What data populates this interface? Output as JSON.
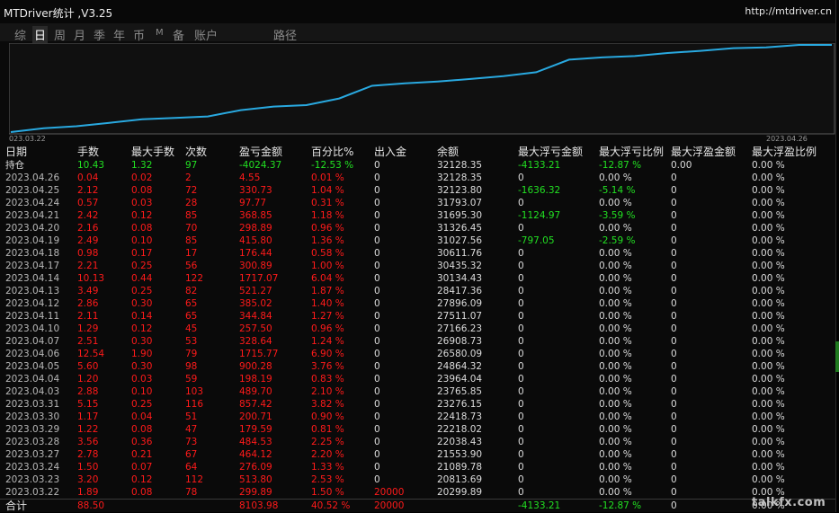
{
  "app": {
    "title": "MTDriver统计 ,V3.25",
    "site": "http://mtdriver.cn"
  },
  "tabs": [
    {
      "label": "综",
      "active": false
    },
    {
      "label": "日",
      "active": true
    },
    {
      "label": "周",
      "active": false
    },
    {
      "label": "月",
      "active": false
    },
    {
      "label": "季",
      "active": false
    },
    {
      "label": "年",
      "active": false
    },
    {
      "label": "币",
      "active": false
    },
    {
      "label": "M",
      "active": false
    },
    {
      "label": "备",
      "active": false
    },
    {
      "label": "账户",
      "active": false
    },
    {
      "label": "路径",
      "active": false
    }
  ],
  "chart_data": {
    "type": "line",
    "x_start_label": "023.03.22",
    "x_end_label": "2023.04.26",
    "series": [
      {
        "color": "#29a9e0",
        "x": [
          "2023.03.22",
          "2023.03.23",
          "2023.03.24",
          "2023.03.27",
          "2023.03.28",
          "2023.03.29",
          "2023.03.30",
          "2023.03.31",
          "2023.04.03",
          "2023.04.04",
          "2023.04.05",
          "2023.04.06",
          "2023.04.07",
          "2023.04.10",
          "2023.04.11",
          "2023.04.12",
          "2023.04.13",
          "2023.04.14",
          "2023.04.17",
          "2023.04.18",
          "2023.04.19",
          "2023.04.20",
          "2023.04.21",
          "2023.04.24",
          "2023.04.25",
          "2023.04.26"
        ],
        "values": [
          20299.89,
          20813.69,
          21089.78,
          21553.9,
          22038.43,
          22218.02,
          22418.73,
          23276.15,
          23765.85,
          23964.04,
          24864.32,
          26580.09,
          26908.73,
          27166.23,
          27511.07,
          27896.09,
          28417.36,
          30134.43,
          30435.32,
          30611.76,
          31027.56,
          31326.45,
          31695.3,
          31793.07,
          32123.8,
          32128.35
        ]
      }
    ]
  },
  "table": {
    "headers": [
      "日期",
      "手数",
      "最大手数",
      "次数",
      "盈亏金额",
      "百分比%",
      "出入金",
      "余额",
      "最大浮亏金额",
      "最大浮亏比例",
      "最大浮盈金额",
      "最大浮盈比例"
    ],
    "position_row": {
      "cells": [
        "持仓",
        "10.43",
        "1.32",
        "97",
        "-4024.37",
        "-12.53 %",
        "0",
        "32128.35",
        "-4133.21",
        "-12.87 %",
        "0.00",
        "0.00 %"
      ],
      "colors": [
        "wht",
        "grn",
        "grn",
        "grn",
        "grn",
        "grn",
        "wht",
        "wht",
        "grn",
        "grn",
        "wht",
        "wht"
      ]
    },
    "rows": [
      {
        "cells": [
          "2023.04.26",
          "0.04",
          "0.02",
          "2",
          "4.55",
          "0.01 %",
          "0",
          "32128.35",
          "0",
          "0.00 %",
          "0",
          "0.00 %"
        ],
        "colors": [
          "gry",
          "red",
          "red",
          "red",
          "red",
          "red",
          "wht",
          "wht",
          "wht",
          "wht",
          "wht",
          "wht"
        ]
      },
      {
        "cells": [
          "2023.04.25",
          "2.12",
          "0.08",
          "72",
          "330.73",
          "1.04 %",
          "0",
          "32123.80",
          "-1636.32",
          "-5.14 %",
          "0",
          "0.00 %"
        ],
        "colors": [
          "gry",
          "red",
          "red",
          "red",
          "red",
          "red",
          "wht",
          "wht",
          "grn",
          "grn",
          "wht",
          "wht"
        ]
      },
      {
        "cells": [
          "2023.04.24",
          "0.57",
          "0.03",
          "28",
          "97.77",
          "0.31 %",
          "0",
          "31793.07",
          "0",
          "0.00 %",
          "0",
          "0.00 %"
        ],
        "colors": [
          "gry",
          "red",
          "red",
          "red",
          "red",
          "red",
          "wht",
          "wht",
          "wht",
          "wht",
          "wht",
          "wht"
        ]
      },
      {
        "cells": [
          "2023.04.21",
          "2.42",
          "0.12",
          "85",
          "368.85",
          "1.18 %",
          "0",
          "31695.30",
          "-1124.97",
          "-3.59 %",
          "0",
          "0.00 %"
        ],
        "colors": [
          "gry",
          "red",
          "red",
          "red",
          "red",
          "red",
          "wht",
          "wht",
          "grn",
          "grn",
          "wht",
          "wht"
        ]
      },
      {
        "cells": [
          "2023.04.20",
          "2.16",
          "0.08",
          "70",
          "298.89",
          "0.96 %",
          "0",
          "31326.45",
          "0",
          "0.00 %",
          "0",
          "0.00 %"
        ],
        "colors": [
          "gry",
          "red",
          "red",
          "red",
          "red",
          "red",
          "wht",
          "wht",
          "wht",
          "wht",
          "wht",
          "wht"
        ]
      },
      {
        "cells": [
          "2023.04.19",
          "2.49",
          "0.10",
          "85",
          "415.80",
          "1.36 %",
          "0",
          "31027.56",
          "-797.05",
          "-2.59 %",
          "0",
          "0.00 %"
        ],
        "colors": [
          "gry",
          "red",
          "red",
          "red",
          "red",
          "red",
          "wht",
          "wht",
          "grn",
          "grn",
          "wht",
          "wht"
        ]
      },
      {
        "cells": [
          "2023.04.18",
          "0.98",
          "0.17",
          "17",
          "176.44",
          "0.58 %",
          "0",
          "30611.76",
          "0",
          "0.00 %",
          "0",
          "0.00 %"
        ],
        "colors": [
          "gry",
          "red",
          "red",
          "red",
          "red",
          "red",
          "wht",
          "wht",
          "wht",
          "wht",
          "wht",
          "wht"
        ]
      },
      {
        "cells": [
          "2023.04.17",
          "2.21",
          "0.25",
          "56",
          "300.89",
          "1.00 %",
          "0",
          "30435.32",
          "0",
          "0.00 %",
          "0",
          "0.00 %"
        ],
        "colors": [
          "gry",
          "red",
          "red",
          "red",
          "red",
          "red",
          "wht",
          "wht",
          "wht",
          "wht",
          "wht",
          "wht"
        ]
      },
      {
        "cells": [
          "2023.04.14",
          "10.13",
          "0.44",
          "122",
          "1717.07",
          "6.04 %",
          "0",
          "30134.43",
          "0",
          "0.00 %",
          "0",
          "0.00 %"
        ],
        "colors": [
          "gry",
          "red",
          "red",
          "red",
          "red",
          "red",
          "wht",
          "wht",
          "wht",
          "wht",
          "wht",
          "wht"
        ]
      },
      {
        "cells": [
          "2023.04.13",
          "3.49",
          "0.25",
          "82",
          "521.27",
          "1.87 %",
          "0",
          "28417.36",
          "0",
          "0.00 %",
          "0",
          "0.00 %"
        ],
        "colors": [
          "gry",
          "red",
          "red",
          "red",
          "red",
          "red",
          "wht",
          "wht",
          "wht",
          "wht",
          "wht",
          "wht"
        ]
      },
      {
        "cells": [
          "2023.04.12",
          "2.86",
          "0.30",
          "65",
          "385.02",
          "1.40 %",
          "0",
          "27896.09",
          "0",
          "0.00 %",
          "0",
          "0.00 %"
        ],
        "colors": [
          "gry",
          "red",
          "red",
          "red",
          "red",
          "red",
          "wht",
          "wht",
          "wht",
          "wht",
          "wht",
          "wht"
        ]
      },
      {
        "cells": [
          "2023.04.11",
          "2.11",
          "0.14",
          "65",
          "344.84",
          "1.27 %",
          "0",
          "27511.07",
          "0",
          "0.00 %",
          "0",
          "0.00 %"
        ],
        "colors": [
          "gry",
          "red",
          "red",
          "red",
          "red",
          "red",
          "wht",
          "wht",
          "wht",
          "wht",
          "wht",
          "wht"
        ]
      },
      {
        "cells": [
          "2023.04.10",
          "1.29",
          "0.12",
          "45",
          "257.50",
          "0.96 %",
          "0",
          "27166.23",
          "0",
          "0.00 %",
          "0",
          "0.00 %"
        ],
        "colors": [
          "gry",
          "red",
          "red",
          "red",
          "red",
          "red",
          "wht",
          "wht",
          "wht",
          "wht",
          "wht",
          "wht"
        ]
      },
      {
        "cells": [
          "2023.04.07",
          "2.51",
          "0.30",
          "53",
          "328.64",
          "1.24 %",
          "0",
          "26908.73",
          "0",
          "0.00 %",
          "0",
          "0.00 %"
        ],
        "colors": [
          "gry",
          "red",
          "red",
          "red",
          "red",
          "red",
          "wht",
          "wht",
          "wht",
          "wht",
          "wht",
          "wht"
        ]
      },
      {
        "cells": [
          "2023.04.06",
          "12.54",
          "1.90",
          "79",
          "1715.77",
          "6.90 %",
          "0",
          "26580.09",
          "0",
          "0.00 %",
          "0",
          "0.00 %"
        ],
        "colors": [
          "gry",
          "red",
          "red",
          "red",
          "red",
          "red",
          "wht",
          "wht",
          "wht",
          "wht",
          "wht",
          "wht"
        ]
      },
      {
        "cells": [
          "2023.04.05",
          "5.60",
          "0.30",
          "98",
          "900.28",
          "3.76 %",
          "0",
          "24864.32",
          "0",
          "0.00 %",
          "0",
          "0.00 %"
        ],
        "colors": [
          "gry",
          "red",
          "red",
          "red",
          "red",
          "red",
          "wht",
          "wht",
          "wht",
          "wht",
          "wht",
          "wht"
        ]
      },
      {
        "cells": [
          "2023.04.04",
          "1.20",
          "0.03",
          "59",
          "198.19",
          "0.83 %",
          "0",
          "23964.04",
          "0",
          "0.00 %",
          "0",
          "0.00 %"
        ],
        "colors": [
          "gry",
          "red",
          "red",
          "red",
          "red",
          "red",
          "wht",
          "wht",
          "wht",
          "wht",
          "wht",
          "wht"
        ]
      },
      {
        "cells": [
          "2023.04.03",
          "2.88",
          "0.10",
          "103",
          "489.70",
          "2.10 %",
          "0",
          "23765.85",
          "0",
          "0.00 %",
          "0",
          "0.00 %"
        ],
        "colors": [
          "gry",
          "red",
          "red",
          "red",
          "red",
          "red",
          "wht",
          "wht",
          "wht",
          "wht",
          "wht",
          "wht"
        ]
      },
      {
        "cells": [
          "2023.03.31",
          "5.15",
          "0.25",
          "116",
          "857.42",
          "3.82 %",
          "0",
          "23276.15",
          "0",
          "0.00 %",
          "0",
          "0.00 %"
        ],
        "colors": [
          "gry",
          "red",
          "red",
          "red",
          "red",
          "red",
          "wht",
          "wht",
          "wht",
          "wht",
          "wht",
          "wht"
        ]
      },
      {
        "cells": [
          "2023.03.30",
          "1.17",
          "0.04",
          "51",
          "200.71",
          "0.90 %",
          "0",
          "22418.73",
          "0",
          "0.00 %",
          "0",
          "0.00 %"
        ],
        "colors": [
          "gry",
          "red",
          "red",
          "red",
          "red",
          "red",
          "wht",
          "wht",
          "wht",
          "wht",
          "wht",
          "wht"
        ]
      },
      {
        "cells": [
          "2023.03.29",
          "1.22",
          "0.08",
          "47",
          "179.59",
          "0.81 %",
          "0",
          "22218.02",
          "0",
          "0.00 %",
          "0",
          "0.00 %"
        ],
        "colors": [
          "gry",
          "red",
          "red",
          "red",
          "red",
          "red",
          "wht",
          "wht",
          "wht",
          "wht",
          "wht",
          "wht"
        ]
      },
      {
        "cells": [
          "2023.03.28",
          "3.56",
          "0.36",
          "73",
          "484.53",
          "2.25 %",
          "0",
          "22038.43",
          "0",
          "0.00 %",
          "0",
          "0.00 %"
        ],
        "colors": [
          "gry",
          "red",
          "red",
          "red",
          "red",
          "red",
          "wht",
          "wht",
          "wht",
          "wht",
          "wht",
          "wht"
        ]
      },
      {
        "cells": [
          "2023.03.27",
          "2.78",
          "0.21",
          "67",
          "464.12",
          "2.20 %",
          "0",
          "21553.90",
          "0",
          "0.00 %",
          "0",
          "0.00 %"
        ],
        "colors": [
          "gry",
          "red",
          "red",
          "red",
          "red",
          "red",
          "wht",
          "wht",
          "wht",
          "wht",
          "wht",
          "wht"
        ]
      },
      {
        "cells": [
          "2023.03.24",
          "1.50",
          "0.07",
          "64",
          "276.09",
          "1.33 %",
          "0",
          "21089.78",
          "0",
          "0.00 %",
          "0",
          "0.00 %"
        ],
        "colors": [
          "gry",
          "red",
          "red",
          "red",
          "red",
          "red",
          "wht",
          "wht",
          "wht",
          "wht",
          "wht",
          "wht"
        ]
      },
      {
        "cells": [
          "2023.03.23",
          "3.20",
          "0.12",
          "112",
          "513.80",
          "2.53 %",
          "0",
          "20813.69",
          "0",
          "0.00 %",
          "0",
          "0.00 %"
        ],
        "colors": [
          "gry",
          "red",
          "red",
          "red",
          "red",
          "red",
          "wht",
          "wht",
          "wht",
          "wht",
          "wht",
          "wht"
        ]
      },
      {
        "cells": [
          "2023.03.22",
          "1.89",
          "0.08",
          "78",
          "299.89",
          "1.50 %",
          "20000",
          "20299.89",
          "0",
          "0.00 %",
          "0",
          "0.00 %"
        ],
        "colors": [
          "gry",
          "red",
          "red",
          "red",
          "red",
          "red",
          "red",
          "wht",
          "wht",
          "wht",
          "wht",
          "wht"
        ]
      }
    ],
    "total_row": {
      "cells": [
        "合计",
        "88.50",
        "",
        "",
        "8103.98",
        "40.52 %",
        "20000",
        "",
        "-4133.21",
        "-12.87 %",
        "0",
        "0.00 %"
      ],
      "colors": [
        "wht",
        "red",
        "red",
        "red",
        "red",
        "red",
        "red",
        "wht",
        "grn",
        "grn",
        "wht",
        "wht"
      ]
    }
  },
  "watermark": "talkfx.com",
  "colors": {
    "background": "#0a0a0a",
    "line": "#29a9e0",
    "profit": "#ff1a1a",
    "loss": "#22e022"
  }
}
